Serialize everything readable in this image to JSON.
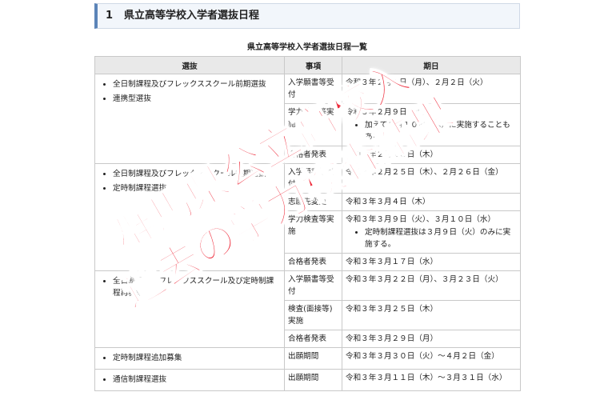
{
  "section": {
    "number": "1",
    "title": "県立高等学校入学者選抜日程"
  },
  "table": {
    "caption": "県立高等学校入学者選抜日程一覧",
    "headers": [
      "選抜",
      "事項",
      "期日"
    ],
    "groups": [
      {
        "selections": [
          "全日制課程及びフレックススクール前期選抜",
          "連携型選抜"
        ],
        "rows": [
          {
            "item": "入学願書等受付",
            "date": "令和３年２月１日（月）、２月２日（火）"
          },
          {
            "item": "学力検査等実施",
            "date": "令和３年２月９日（火）",
            "note": "加えて２月１０日（水）に実施することもある"
          },
          {
            "item": "合格者発表",
            "date": "令和３年２月１８日（木）"
          }
        ]
      },
      {
        "selections": [
          "全日制課程及びフレックススクール後期選抜",
          "定時制課程選抜"
        ],
        "rows": [
          {
            "item": "入学願書等受付",
            "date": "令和３年２月２５日（木）、２月２６日（金）"
          },
          {
            "item": "志願先変更",
            "date": "令和３年３月４日（木）"
          },
          {
            "item": "学力検査等実施",
            "date": "令和３年３月９日（火）、３月１０日（水）",
            "note": "定時制課程選抜は３月９日（火）のみに実施する。"
          },
          {
            "item": "合格者発表",
            "date": "令和３年３月１７日（水）"
          }
        ]
      },
      {
        "selections": [
          "全日制課程、フレックススクール及び定時制課程再募集"
        ],
        "rows": [
          {
            "item": "入学願書等受付",
            "date": "令和３年３月２２日（月）、３月２３日（火）"
          },
          {
            "item": "検査(面接等)実施",
            "date": "令和３年３月２５日（木）"
          },
          {
            "item": "合格者発表",
            "date": "令和３年３月２９日（月）"
          }
        ]
      },
      {
        "selections": [
          "定時制課程追加募集"
        ],
        "rows": [
          {
            "item": "出願期間",
            "date": "令和３年３月３０日（火）～４月２日（金）"
          }
        ]
      },
      {
        "selections": [
          "通信制課程選抜"
        ],
        "rows": [
          {
            "item": "出願期間",
            "date": "令和３年３月１１日（木）～３月３１日（水）"
          }
        ]
      }
    ]
  },
  "overlay": {
    "line1": "群馬県公立高校入",
    "line2": "過去の学力検査結果",
    "color": "#ee2a3a"
  }
}
